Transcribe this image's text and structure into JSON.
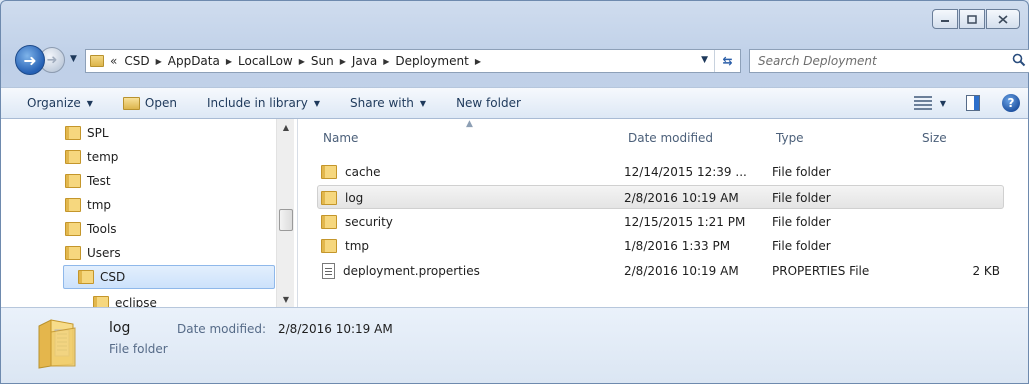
{
  "window": {
    "caption_buttons": [
      "minimize",
      "maximize",
      "close"
    ]
  },
  "navigation": {
    "back_icon": "back-arrow-icon",
    "forward_icon": "forward-arrow-icon",
    "overflow": "«",
    "breadcrumbs": [
      "CSD",
      "AppData",
      "LocalLow",
      "Sun",
      "Java",
      "Deployment"
    ],
    "search_placeholder": "Search Deployment"
  },
  "toolbar": {
    "organize": "Organize",
    "open": "Open",
    "include_in_library": "Include in library",
    "share_with": "Share with",
    "new_folder": "New folder"
  },
  "nav_tree": {
    "items": [
      {
        "label": "SPL",
        "selected": false
      },
      {
        "label": "temp",
        "selected": false
      },
      {
        "label": "Test",
        "selected": false
      },
      {
        "label": "tmp",
        "selected": false
      },
      {
        "label": "Tools",
        "selected": false
      },
      {
        "label": "Users",
        "selected": false
      },
      {
        "label": "CSD",
        "selected": true
      },
      {
        "label": "eclipse",
        "selected": false
      }
    ]
  },
  "file_list": {
    "columns": [
      "Name",
      "Date modified",
      "Type",
      "Size"
    ],
    "rows": [
      {
        "name": "cache",
        "date": "12/14/2015 12:39 ...",
        "type": "File folder",
        "size": "",
        "icon": "folder-icon",
        "selected": false
      },
      {
        "name": "log",
        "date": "2/8/2016 10:19 AM",
        "type": "File folder",
        "size": "",
        "icon": "folder-icon",
        "selected": true
      },
      {
        "name": "security",
        "date": "12/15/2015 1:21 PM",
        "type": "File folder",
        "size": "",
        "icon": "folder-icon",
        "selected": false
      },
      {
        "name": "tmp",
        "date": "1/8/2016 1:33 PM",
        "type": "File folder",
        "size": "",
        "icon": "folder-icon",
        "selected": false
      },
      {
        "name": "deployment.properties",
        "date": "2/8/2016 10:19 AM",
        "type": "PROPERTIES File",
        "size": "2 KB",
        "icon": "properties-file-icon",
        "selected": false
      }
    ]
  },
  "details": {
    "name": "log",
    "date_label": "Date modified:",
    "date_value": "2/8/2016 10:19 AM",
    "type": "File folder"
  }
}
